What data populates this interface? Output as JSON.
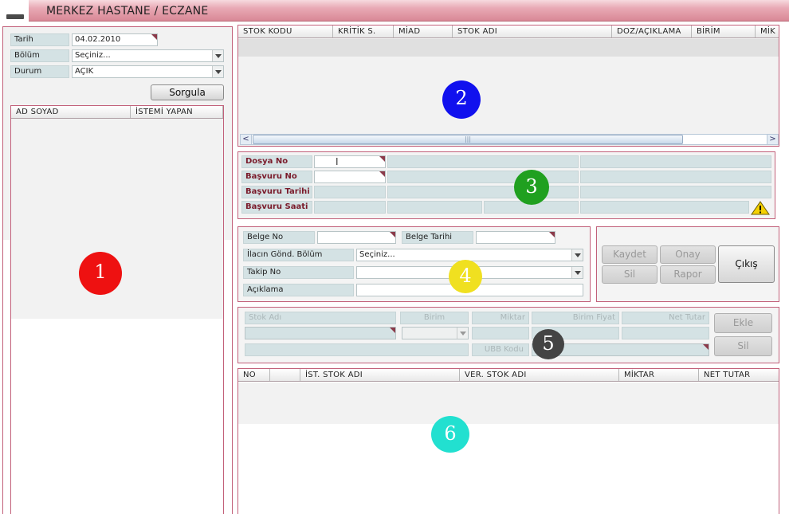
{
  "app": {
    "title": "MERKEZ HASTANE / ECZANE"
  },
  "left": {
    "tarih_label": "Tarih",
    "tarih_value": "04.02.2010",
    "bolum_label": "Bölüm",
    "bolum_value": "Seçiniz...",
    "durum_label": "Durum",
    "durum_value": "AÇIK",
    "sorgula_button": "Sorgula",
    "columns": [
      "AD SOYAD",
      "İSTEMİ YAPAN"
    ]
  },
  "stock_table": {
    "columns": [
      "STOK KODU",
      "KRİTİK S.",
      "MİAD",
      "STOK ADI",
      "DOZ/AÇIKLAMA",
      "BİRİM",
      "MİK"
    ]
  },
  "patient": {
    "dosya_no": "Dosya No",
    "basvuru_no": "Başvuru No",
    "basvuru_tarihi": "Başvuru Tarihi",
    "basvuru_saati": "Başvuru Saati"
  },
  "document": {
    "belge_no": "Belge No",
    "belge_tarihi": "Belge Tarihi",
    "ilacin_gond_bolum": "İlacın Gönd. Bölüm",
    "ilacin_gond_bolum_value": "Seçiniz...",
    "takip_no": "Takip No",
    "aciklama": "Açıklama"
  },
  "actions": {
    "kaydet": "Kaydet",
    "onay": "Onay",
    "cikis": "Çıkış",
    "sil": "Sil",
    "rapor": "Rapor"
  },
  "item_entry": {
    "stok_adi": "Stok Adı",
    "birim": "Birim",
    "miktar": "Miktar",
    "birim_fiyat": "Birim Fiyat",
    "net_tutar": "Net Tutar",
    "ubb_kodu": "UBB Kodu",
    "ekle": "Ekle",
    "sil": "Sil"
  },
  "items_table": {
    "columns": [
      "NO",
      "",
      "İST. STOK ADI",
      "VER. STOK ADI",
      "MİKTAR",
      "NET TUTAR"
    ]
  },
  "markers": {
    "m1": {
      "label": "1",
      "color": "#ee1111"
    },
    "m2": {
      "label": "2",
      "color": "#1111ee"
    },
    "m3": {
      "label": "3",
      "color": "#20a020"
    },
    "m4": {
      "label": "4",
      "color": "#f0e020"
    },
    "m5": {
      "label": "5",
      "color": "#444444"
    },
    "m6": {
      "label": "6",
      "color": "#22e0d0"
    }
  }
}
